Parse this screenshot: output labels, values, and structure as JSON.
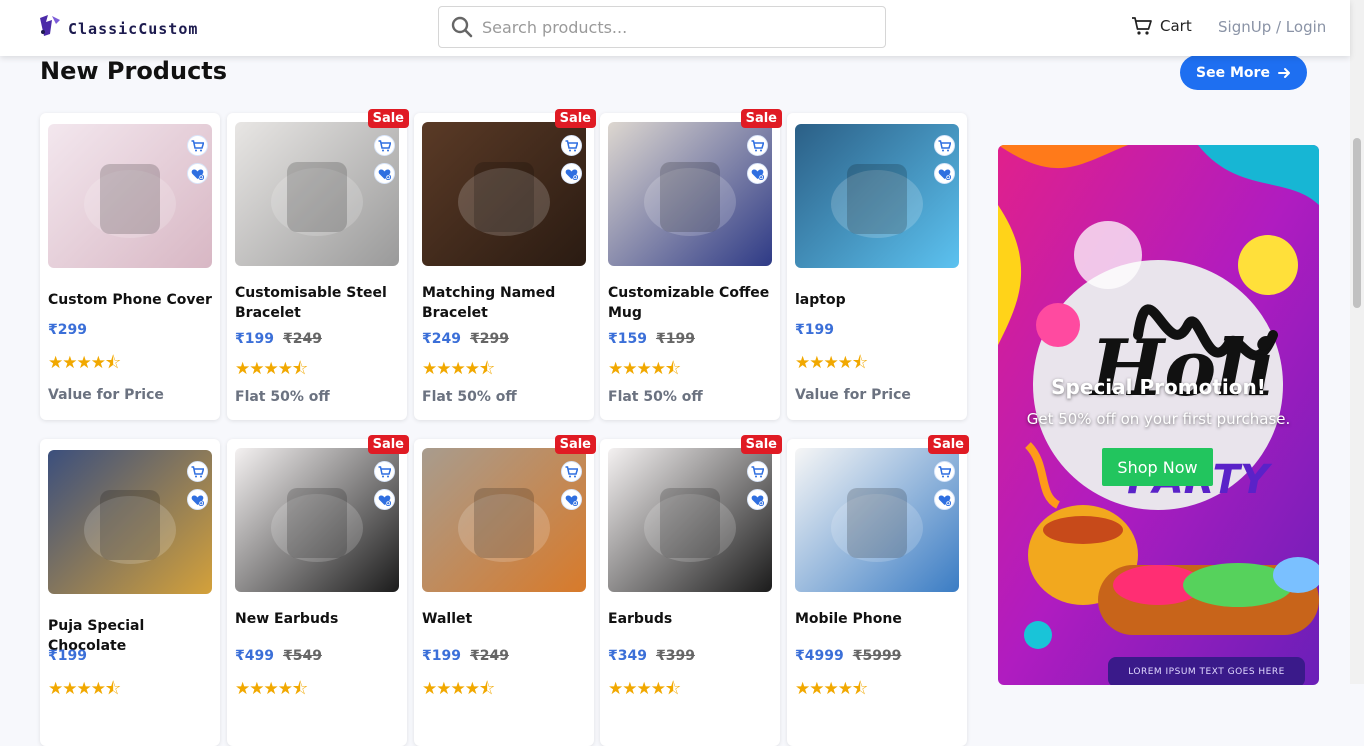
{
  "brand": {
    "name": "ClassicCustom"
  },
  "search": {
    "placeholder": "Search products..."
  },
  "nav": {
    "cart_label": "Cart",
    "login_label": "SignUp / Login"
  },
  "section": {
    "title": "New Products",
    "see_more_label": "See More"
  },
  "sale_label": "Sale",
  "products": [
    {
      "name": "Custom Phone Cover",
      "price": "₹299",
      "old_price": "",
      "note": "Value for Price",
      "sale": false
    },
    {
      "name": "Customisable Steel Bracelet",
      "price": "₹199",
      "old_price": "₹249",
      "note": "Flat 50% off",
      "sale": true
    },
    {
      "name": "Matching Named Bracelet",
      "price": "₹249",
      "old_price": "₹299",
      "note": "Flat 50% off",
      "sale": true
    },
    {
      "name": "Customizable Coffee Mug",
      "price": "₹159",
      "old_price": "₹199",
      "note": "Flat 50% off",
      "sale": true
    },
    {
      "name": "laptop",
      "price": "₹199",
      "old_price": "",
      "note": "Value for Price",
      "sale": false
    },
    {
      "name": "Puja Special Chocolate",
      "price": "₹199",
      "old_price": "",
      "note": "",
      "sale": false
    },
    {
      "name": "New Earbuds",
      "price": "₹499",
      "old_price": "₹549",
      "note": "",
      "sale": true
    },
    {
      "name": "Wallet",
      "price": "₹199",
      "old_price": "₹249",
      "note": "",
      "sale": true
    },
    {
      "name": "Earbuds",
      "price": "₹349",
      "old_price": "₹399",
      "note": "",
      "sale": true
    },
    {
      "name": "Mobile Phone",
      "price": "₹4999",
      "old_price": "₹5999",
      "note": "",
      "sale": true
    }
  ],
  "rating": "★★★★⯪",
  "promo": {
    "title": "Special Promotion!",
    "subtitle": "Get 50% off on your first purchase.",
    "button_label": "Shop Now",
    "footer_text": "LOREM IPSUM TEXT GOES HERE",
    "art_title": "Holi",
    "art_sub": "PARTY"
  },
  "colors": {
    "accent": "#1e6ff1",
    "price": "#3b6fd8",
    "sale": "#e01b24",
    "star": "#f1a800",
    "cta": "#22c55e"
  }
}
